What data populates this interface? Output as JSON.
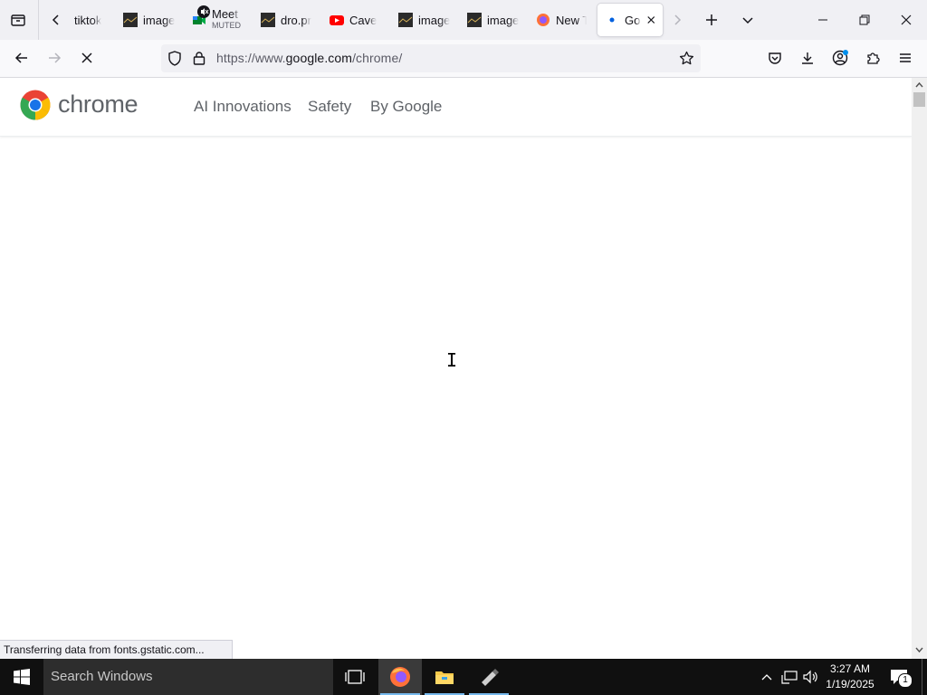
{
  "browser": {
    "tabs": [
      {
        "title": "tiktok",
        "icon": "tiktok-favicon"
      },
      {
        "title": "image",
        "icon": "image-favicon"
      },
      {
        "title": "Meet",
        "subtitle": "MUTED",
        "icon": "meet-favicon"
      },
      {
        "title": "dro.pr",
        "icon": "image-favicon"
      },
      {
        "title": "Cave",
        "icon": "youtube-favicon"
      },
      {
        "title": "image",
        "icon": "image-favicon"
      },
      {
        "title": "image",
        "icon": "image-favicon"
      },
      {
        "title": "New T",
        "icon": "firefox-favicon"
      },
      {
        "title": "Go",
        "icon": "loading-favicon",
        "active": true
      }
    ],
    "url_prefix": "https://www.",
    "url_domain": "google.com",
    "url_path": "/chrome/",
    "status_text": "Transferring data from fonts.gstatic.com..."
  },
  "page": {
    "brand": "chrome",
    "nav": [
      "AI Innovations",
      "Safety",
      "By Google"
    ]
  },
  "taskbar": {
    "search_placeholder": "Search Windows",
    "time": "3:27 AM",
    "date": "1/19/2025",
    "notification_count": "1"
  },
  "colors": {
    "accent": "#76b9ed",
    "chrome_red": "#ea4335",
    "chrome_yellow": "#fbbc04",
    "chrome_green": "#34a853",
    "chrome_blue": "#1a73e8"
  }
}
